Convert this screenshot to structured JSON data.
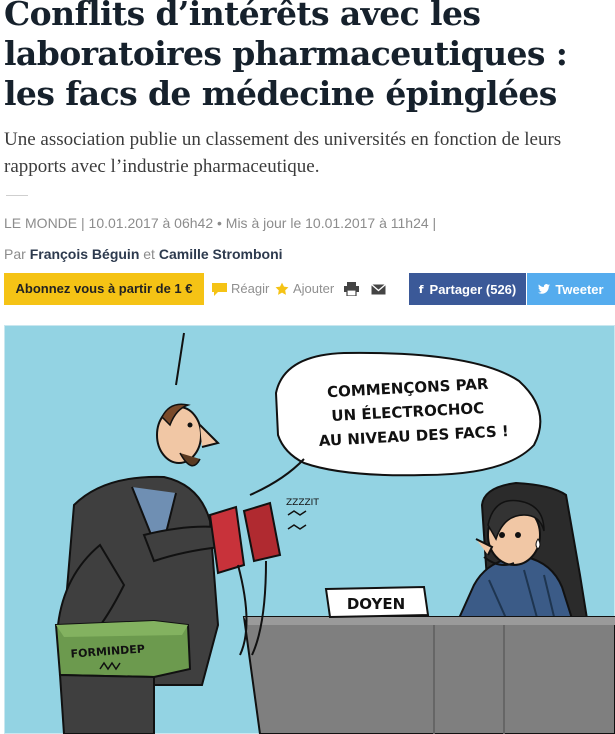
{
  "article": {
    "headline": "Conflits d’intérêts avec les laboratoires pharmaceutiques : les facs de médecine épinglées",
    "lede": "Une association publie un classement des universités en fonction de leurs rapports avec l’industrie pharmaceutique.",
    "meta": "LE MONDE | 10.01.2017 à 06h42 • Mis à jour le 10.01.2017 à 11h24 |",
    "byline_prefix": "Par",
    "author_1": "François Béguin",
    "byline_conj": "et",
    "author_2": "Camille Stromboni"
  },
  "toolbar": {
    "subscribe_label": "Abonnez vous à partir de 1 €",
    "react_label": "Réagir",
    "add_label": "Ajouter",
    "facebook_label": "Partager (526)",
    "twitter_label": "Tweeter"
  },
  "cartoon": {
    "speech_line_1": "COMMENÇONS PAR",
    "speech_line_2": "UN ÉLECTROCHOC",
    "speech_line_3": "AU NIVEAU DES FACS !",
    "sound_effect": "ZZZZIT",
    "machine_label": "FORMINDEP",
    "desk_sign": "DOYEN"
  },
  "colors": {
    "subscribe_bg": "#f5c315",
    "facebook_bg": "#3b5998",
    "twitter_bg": "#55acee",
    "cartoon_sky": "#8fcfe0"
  },
  "icons": [
    "speech-bubble-icon",
    "star-icon",
    "print-icon",
    "mail-icon",
    "facebook-icon",
    "twitter-icon"
  ]
}
